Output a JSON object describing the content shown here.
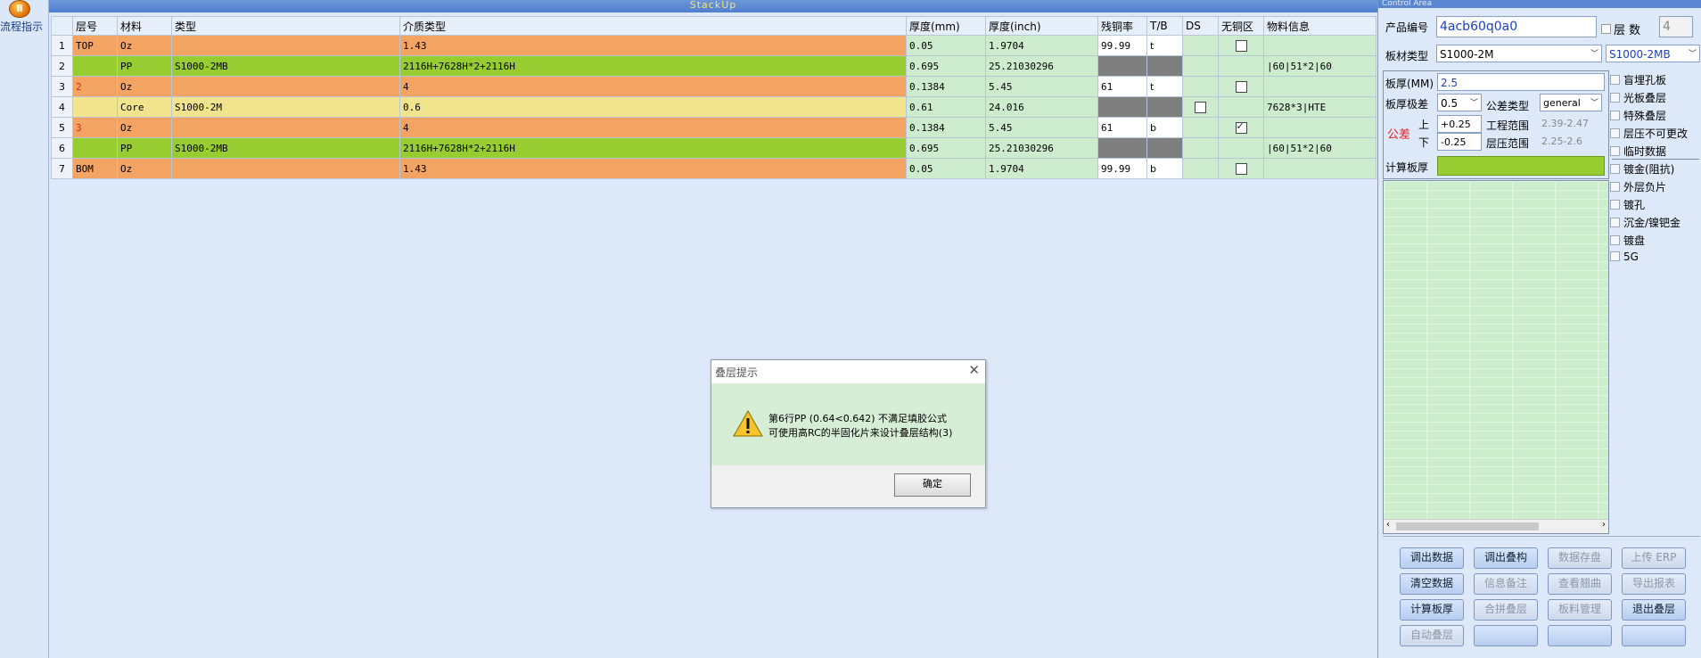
{
  "left": {
    "guide_label": "流程指示"
  },
  "stack": {
    "title": "StackUp",
    "columns": [
      "层号",
      "材料",
      "类型",
      "介质类型",
      "厚度(mm)",
      "厚度(inch)",
      "残铜率",
      "T/B",
      "DS",
      "无铜区",
      "物料信息"
    ],
    "rows": [
      {
        "num": "1",
        "layer": "TOP",
        "material": "Oz",
        "type": "",
        "dielectric": "1.43",
        "mm": "0.05",
        "inch": "1.9704",
        "copper": "99.99",
        "tb": "t",
        "ds": "",
        "nocu": "box",
        "info": "",
        "style": "oz"
      },
      {
        "num": "2",
        "layer": "",
        "material": "PP",
        "type": "S1000-2MB",
        "dielectric": "2116H+7628H*2+2116H",
        "mm": "0.695",
        "inch": "25.21030296",
        "copper": "",
        "tb": "",
        "ds": "",
        "nocu": "",
        "info": "|60|51*2|60",
        "style": "pp"
      },
      {
        "num": "3",
        "layer": "2",
        "material": "Oz",
        "type": "",
        "dielectric": "4",
        "mm": "0.1384",
        "inch": "5.45",
        "copper": "61",
        "tb": "t",
        "ds": "",
        "nocu": "box",
        "info": "",
        "style": "oz"
      },
      {
        "num": "4",
        "layer": "",
        "material": "Core",
        "type": "S1000-2M",
        "dielectric": "0.6",
        "mm": "0.61",
        "inch": "24.016",
        "copper": "",
        "tb": "",
        "ds": "box",
        "nocu": "",
        "info": "7628*3|HTE",
        "style": "core"
      },
      {
        "num": "5",
        "layer": "3",
        "material": "Oz",
        "type": "",
        "dielectric": "4",
        "mm": "0.1384",
        "inch": "5.45",
        "copper": "61",
        "tb": "b",
        "ds": "",
        "nocu": "checked",
        "info": "",
        "style": "oz"
      },
      {
        "num": "6",
        "layer": "",
        "material": "PP",
        "type": "S1000-2MB",
        "dielectric": "2116H+7628H*2+2116H",
        "mm": "0.695",
        "inch": "25.21030296",
        "copper": "",
        "tb": "",
        "ds": "",
        "nocu": "",
        "info": "|60|51*2|60",
        "style": "pp"
      },
      {
        "num": "7",
        "layer": "BOM",
        "material": "Oz",
        "type": "",
        "dielectric": "1.43",
        "mm": "0.05",
        "inch": "1.9704",
        "copper": "99.99",
        "tb": "b",
        "ds": "",
        "nocu": "box",
        "info": "",
        "style": "oz"
      }
    ]
  },
  "dialog": {
    "title": "叠层提示",
    "close": "✕",
    "line1": "第6行PP (0.64<0.642) 不满足填胶公式",
    "line2": "可使用高RC的半固化片来设计叠层结构(3)",
    "ok": "确定"
  },
  "control": {
    "title": "Control Area",
    "product_label": "产品编号",
    "product_value": "4acb60q0a0",
    "layer_label": "层 数",
    "layer_value": "4",
    "board_type_label": "板材类型",
    "board_type_value": "S1000-2M",
    "board_type_value2": "S1000-2MB",
    "thickness_label": "板厚(MM)",
    "thickness_value": "2.5",
    "tol_label": "板厚极差",
    "tol_value": "0.5",
    "tol_type_label": "公差类型",
    "tol_type_value": "general",
    "tol_word": "公差",
    "up_label": "上",
    "down_label": "下",
    "up_value": "+0.25",
    "down_value": "-0.25",
    "eng_range_label": "工程范围",
    "eng_range_value": "2.39-2.47",
    "press_range_label": "层压范围",
    "press_range_value": "2.25-2.6",
    "calc_label": "计算板厚",
    "calc_value": "",
    "options": [
      "盲埋孔板",
      "光板叠层",
      "特殊叠层",
      "层压不可更改",
      "临时数据",
      "镀金(阻抗)",
      "外层负片",
      "镀孔",
      "沉金/镍钯金",
      "镀盘",
      "5G"
    ],
    "buttons": [
      {
        "label": "调出数据",
        "enabled": true
      },
      {
        "label": "调出叠构",
        "enabled": true
      },
      {
        "label": "数据存盘",
        "enabled": false
      },
      {
        "label": "上传 ERP",
        "enabled": false
      },
      {
        "label": "清空数据",
        "enabled": true
      },
      {
        "label": "信息备注",
        "enabled": false
      },
      {
        "label": "查看翘曲",
        "enabled": false
      },
      {
        "label": "导出报表",
        "enabled": false
      },
      {
        "label": "计算板厚",
        "enabled": true
      },
      {
        "label": "合拼叠层",
        "enabled": false
      },
      {
        "label": "板料管理",
        "enabled": false
      },
      {
        "label": "退出叠层",
        "enabled": true
      },
      {
        "label": "自动叠层",
        "enabled": false
      },
      {
        "label": "",
        "enabled": true
      },
      {
        "label": "",
        "enabled": true
      },
      {
        "label": "",
        "enabled": true
      }
    ]
  },
  "colors": {
    "oz": "#f4a462",
    "pp": "#98cd32",
    "core": "#f1e48c",
    "light": "#cdeccd"
  }
}
